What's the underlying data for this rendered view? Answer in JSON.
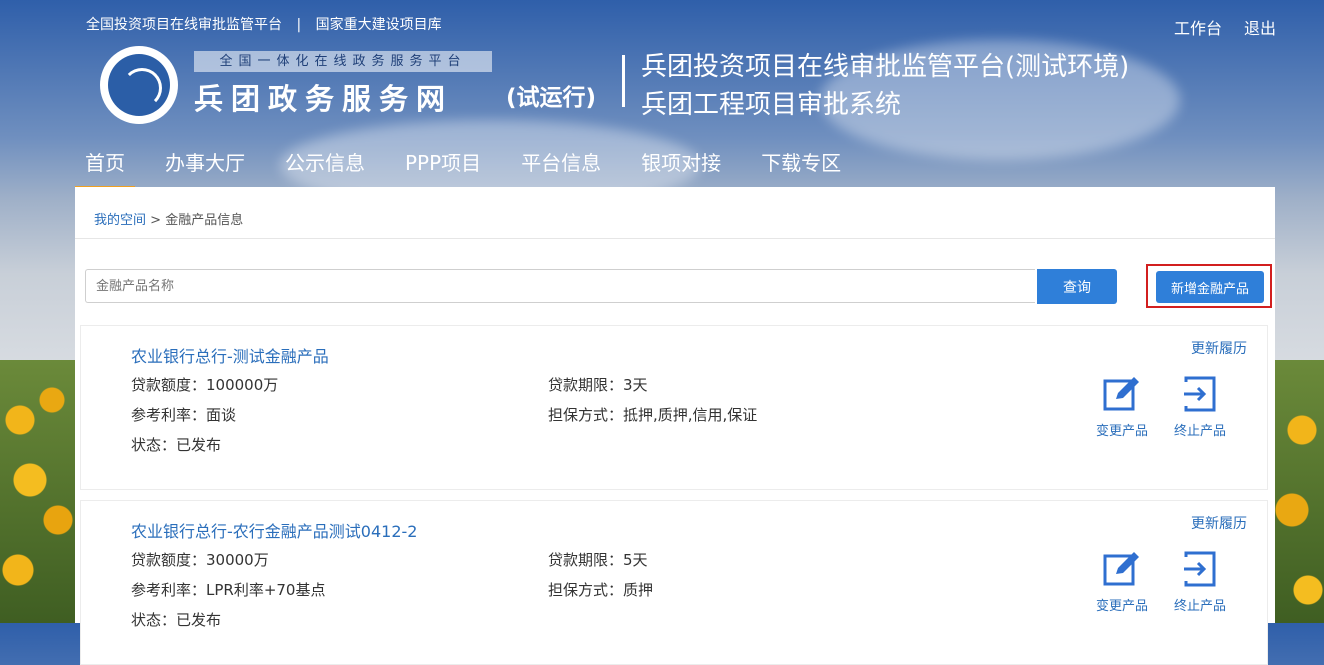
{
  "header": {
    "top_link_1": "全国投资项目在线审批监管平台",
    "top_sep": "|",
    "top_link_2": "国家重大建设项目库",
    "workbench": "工作台",
    "logout": "退出",
    "logo_banner": "全国一体化在线政务服务平台",
    "logo_name": "兵团政务服务网",
    "logo_sub": "(试运行)",
    "title_main": "兵团投资项目在线审批监管平台(测试环境)",
    "title_sub": "兵团工程项目审批系统"
  },
  "nav": {
    "items": [
      {
        "label": "首页"
      },
      {
        "label": "办事大厅"
      },
      {
        "label": "公示信息"
      },
      {
        "label": "PPP项目"
      },
      {
        "label": "平台信息"
      },
      {
        "label": "银项对接"
      },
      {
        "label": "下载专区"
      }
    ]
  },
  "breadcrumb": {
    "root": "我的空间",
    "sep": ">",
    "current": "金融产品信息"
  },
  "search": {
    "placeholder": "金融产品名称",
    "button": "查询",
    "new_button": "新增金融产品"
  },
  "products": [
    {
      "title": "农业银行总行-测试金融产品",
      "amount": "贷款额度：100000万",
      "term": "贷款期限：3天",
      "rate": "参考利率：面谈",
      "guarantee": "担保方式：抵押,质押,信用,保证",
      "status": "状态：已发布",
      "history": "更新履历",
      "change": "变更产品",
      "terminate": "终止产品"
    },
    {
      "title": "农业银行总行-农行金融产品测试0412-2",
      "amount": "贷款额度：30000万",
      "term": "贷款期限：5天",
      "rate": "参考利率：LPR利率+70基点",
      "guarantee": "担保方式：质押",
      "status": "状态：已发布",
      "history": "更新履历",
      "change": "变更产品",
      "terminate": "终止产品"
    }
  ],
  "colors": {
    "primary": "#2f7fd9",
    "link": "#2a6ebb",
    "nav_active": "#f0a020",
    "highlight_border": "#d21f1f"
  }
}
